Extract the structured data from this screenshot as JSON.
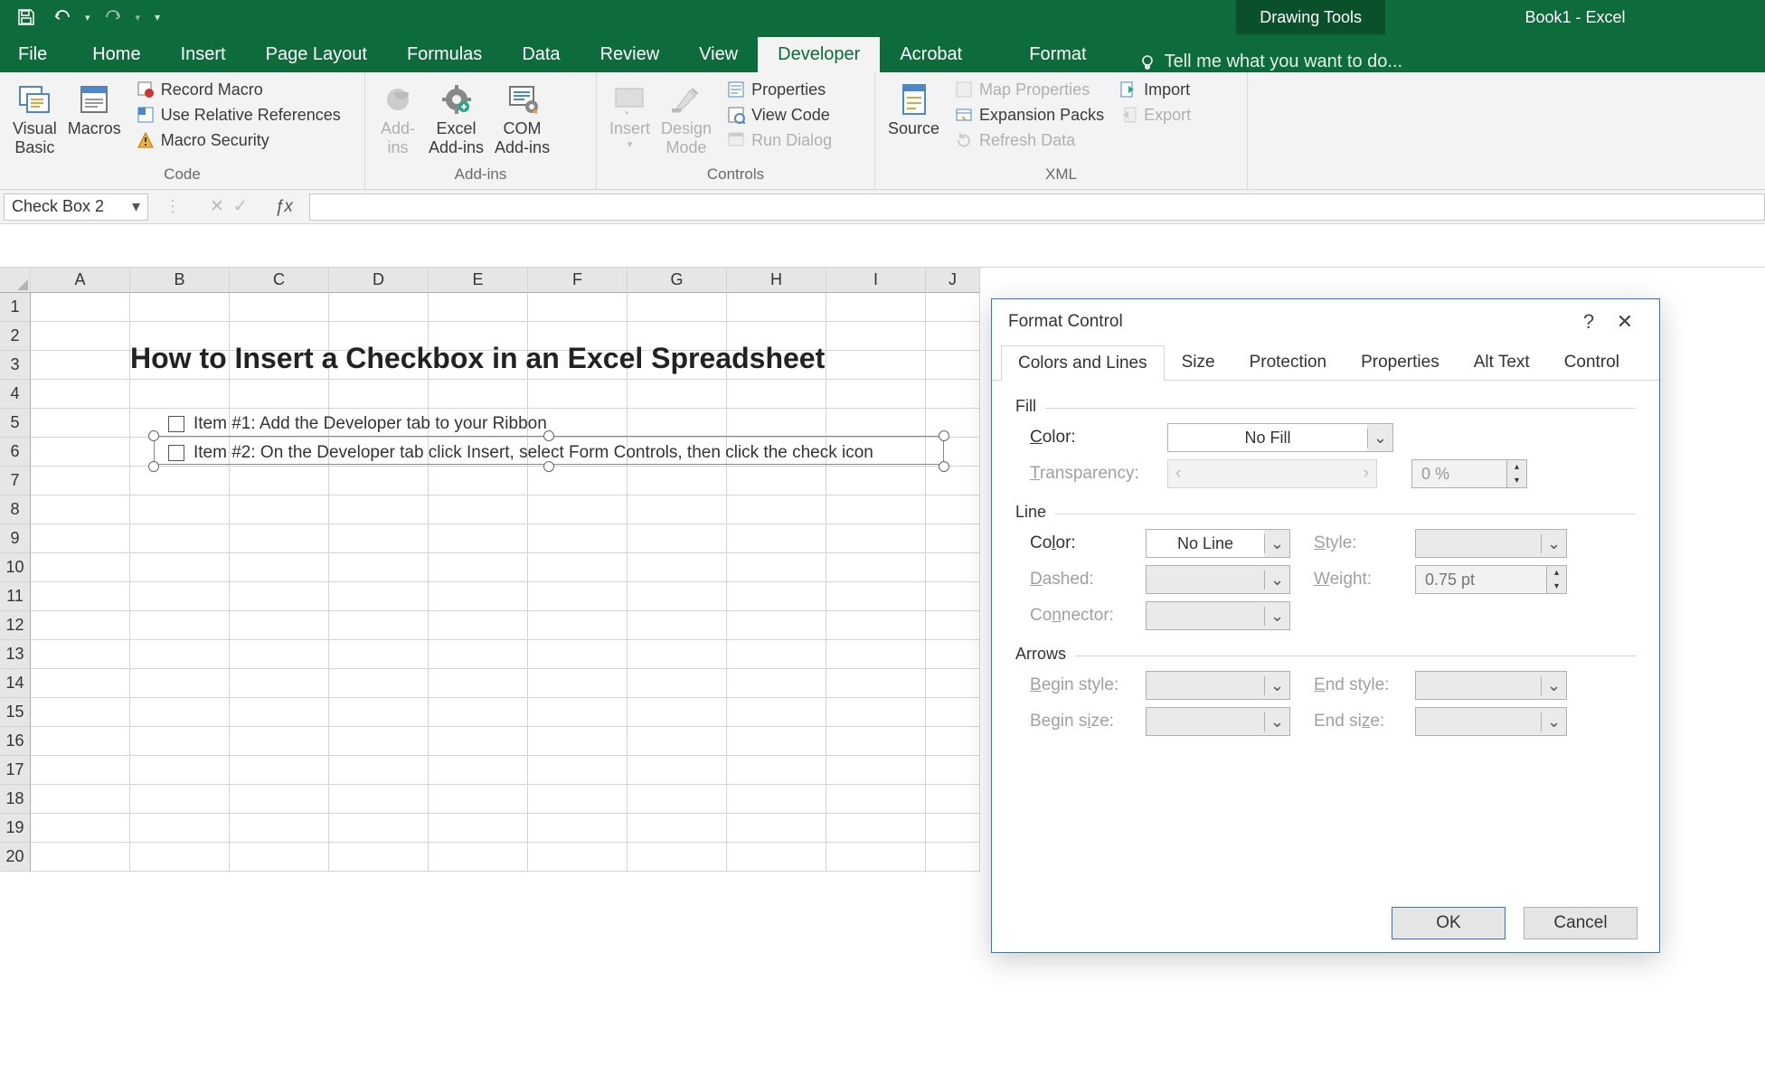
{
  "titlebar": {
    "drawing_tools": "Drawing Tools",
    "app_title": "Book1 - Excel"
  },
  "tabs": {
    "file": "File",
    "home": "Home",
    "insert": "Insert",
    "page_layout": "Page Layout",
    "formulas": "Formulas",
    "data": "Data",
    "review": "Review",
    "view": "View",
    "developer": "Developer",
    "acrobat": "Acrobat",
    "format": "Format",
    "tellme": "Tell me what you want to do..."
  },
  "ribbon": {
    "code": {
      "visual_basic": "Visual\nBasic",
      "macros": "Macros",
      "record_macro": "Record Macro",
      "use_relative": "Use Relative References",
      "macro_security": "Macro Security",
      "group": "Code"
    },
    "addins": {
      "addins": "Add-\nins",
      "excel_addins": "Excel\nAdd-ins",
      "com_addins": "COM\nAdd-ins",
      "group": "Add-ins"
    },
    "controls": {
      "insert": "Insert",
      "design_mode": "Design\nMode",
      "properties": "Properties",
      "view_code": "View Code",
      "run_dialog": "Run Dialog",
      "group": "Controls"
    },
    "xml": {
      "source": "Source",
      "map_properties": "Map Properties",
      "expansion_packs": "Expansion Packs",
      "refresh_data": "Refresh Data",
      "import": "Import",
      "export": "Export",
      "group": "XML"
    }
  },
  "namebox": "Check Box 2",
  "columns": [
    "A",
    "B",
    "C",
    "D",
    "E",
    "F",
    "G",
    "H",
    "I",
    "J"
  ],
  "rows": [
    "1",
    "2",
    "3",
    "4",
    "5",
    "6",
    "7",
    "8",
    "9",
    "10",
    "11",
    "12",
    "13",
    "14",
    "15",
    "16",
    "17",
    "18",
    "19",
    "20"
  ],
  "sheet": {
    "title": "How to Insert a Checkbox in an Excel Spreadsheet",
    "item1": "Item #1: Add the Developer tab to your Ribbon",
    "item2": "Item #2: On the Developer tab click Insert, select Form Controls, then click the check icon"
  },
  "dialog": {
    "title": "Format Control",
    "help": "?",
    "tabs": {
      "colors": "Colors and Lines",
      "size": "Size",
      "protection": "Protection",
      "properties": "Properties",
      "alt_text": "Alt Text",
      "control": "Control"
    },
    "fill": {
      "section": "Fill",
      "color_label": "Color:",
      "color_value": "No Fill",
      "transparency_label": "Transparency:",
      "transparency_value": "0 %"
    },
    "line": {
      "section": "Line",
      "color_label": "Color:",
      "color_value": "No Line",
      "style_label": "Style:",
      "dashed_label": "Dashed:",
      "weight_label": "Weight:",
      "weight_value": "0.75 pt",
      "connector_label": "Connector:"
    },
    "arrows": {
      "section": "Arrows",
      "begin_style": "Begin style:",
      "end_style": "End style:",
      "begin_size": "Begin size:",
      "end_size": "End size:"
    },
    "ok": "OK",
    "cancel": "Cancel"
  }
}
